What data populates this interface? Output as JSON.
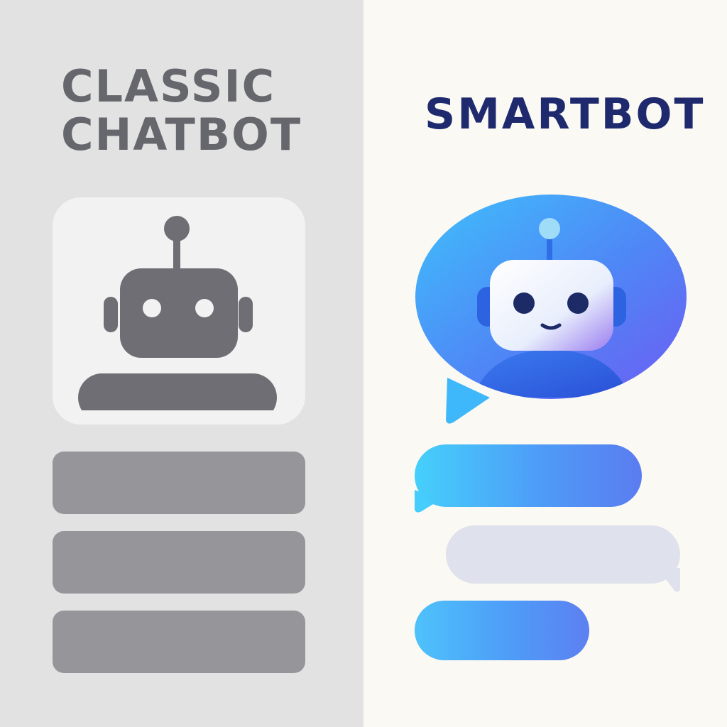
{
  "left": {
    "title_line1": "CLASSIC",
    "title_line2": "CHATBOT",
    "icon": "robot-icon",
    "colors": {
      "background": "#e2e2e2",
      "card": "#f2f2f2",
      "robot": "#6e6e74",
      "bars": "#96969a"
    }
  },
  "right": {
    "title": "SMARTBOT",
    "icon": "robot-chat-bubble-icon",
    "colors": {
      "background": "#fbf9f3",
      "accent_start": "#3fb8fb",
      "accent_end": "#6a5cf2",
      "title": "#1f2a6e",
      "reply": "#dfe2ec"
    }
  }
}
